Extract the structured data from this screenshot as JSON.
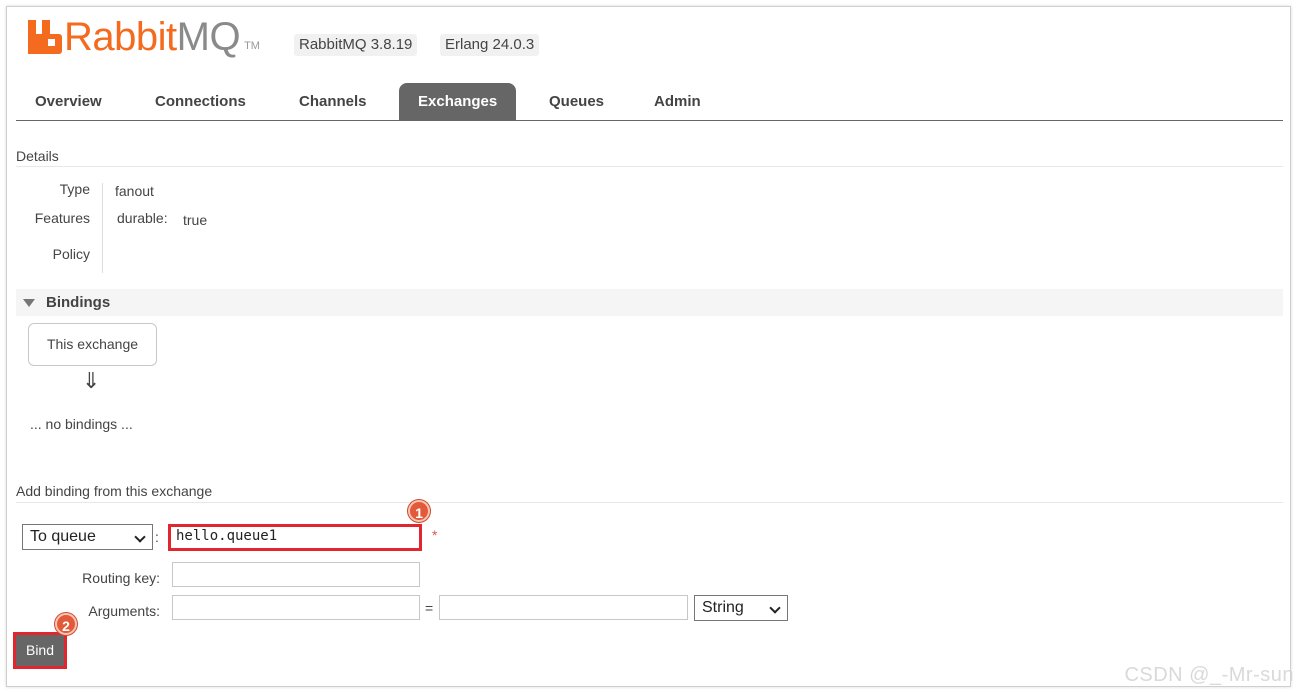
{
  "header": {
    "logo_brand": "RabbitMQ",
    "logo_rabbit": "Rabbit",
    "logo_mq": "MQ",
    "logo_tm": "TM",
    "rabbit_version": "RabbitMQ 3.8.19",
    "erlang_version": "Erlang 24.0.3",
    "brand_color": "#f46a1f"
  },
  "tabs": [
    {
      "label": "Overview",
      "active": false
    },
    {
      "label": "Connections",
      "active": false
    },
    {
      "label": "Channels",
      "active": false
    },
    {
      "label": "Exchanges",
      "active": true
    },
    {
      "label": "Queues",
      "active": false
    },
    {
      "label": "Admin",
      "active": false
    }
  ],
  "details": {
    "title": "Details",
    "type_label": "Type",
    "type_value": "fanout",
    "features_label": "Features",
    "durable_key": "durable:",
    "durable_value": "true",
    "policy_label": "Policy"
  },
  "bindings": {
    "title": "Bindings",
    "this_exchange": "This exchange",
    "arrow": "⇓",
    "no_bindings": "... no bindings ..."
  },
  "add_binding": {
    "title": "Add binding from this exchange",
    "destination_select": "To queue",
    "destination_colon": ":",
    "destination_value": "hello.queue1",
    "required_mark": "*",
    "routing_key_label": "Routing key:",
    "routing_key_value": "",
    "arguments_label": "Arguments:",
    "arg_key_value": "",
    "equals": "=",
    "arg_value_value": "",
    "arg_type_select": "String",
    "bind_button": "Bind"
  },
  "annotations": {
    "marker_1": "1",
    "marker_2": "2",
    "highlight_color": "#e0262e"
  },
  "watermark": "CSDN @_-Mr-sun"
}
